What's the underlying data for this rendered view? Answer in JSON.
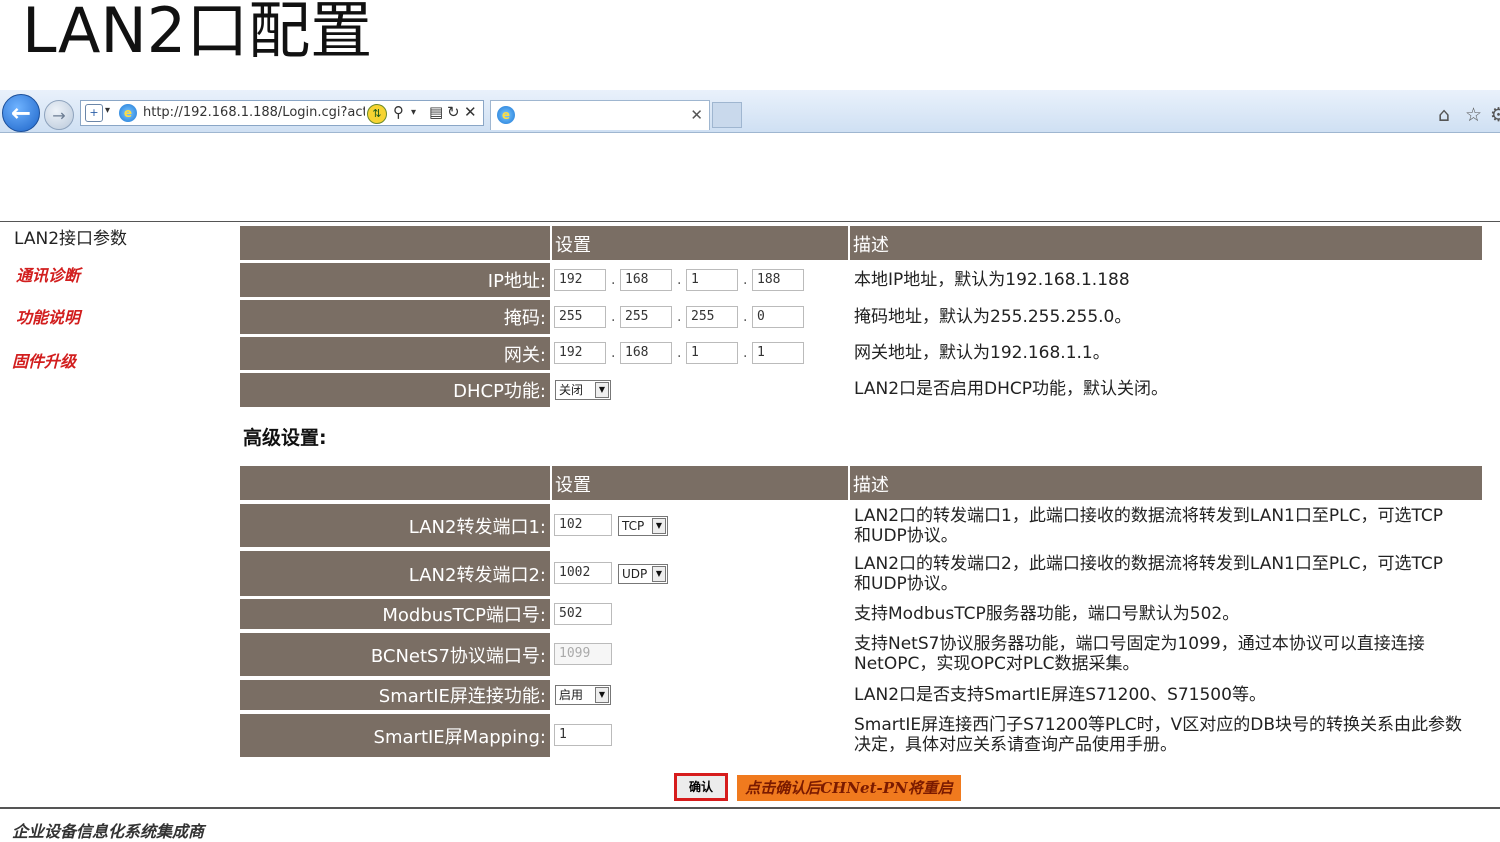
{
  "slide_title": "LAN2口配置",
  "browser": {
    "url": "http://192.168.1.188/Login.cgi?act",
    "icons": [
      "back-icon",
      "forward-icon",
      "shield-icon",
      "ie-icon",
      "compat-icon",
      "search-icon",
      "refresh-icon",
      "close-icon",
      "home-icon",
      "star-icon"
    ]
  },
  "sidebar": {
    "title": "LAN2接口参数",
    "links": [
      "通讯诊断",
      "功能说明",
      "固件升级"
    ]
  },
  "basic": {
    "header_setting": "设置",
    "header_desc": "描述",
    "ip": {
      "label": "IP地址:",
      "octets": [
        "192",
        "168",
        "1",
        "188"
      ],
      "desc": "本地IP地址，默认为192.168.1.188"
    },
    "mask": {
      "label": "掩码:",
      "octets": [
        "255",
        "255",
        "255",
        "0"
      ],
      "desc": "掩码地址，默认为255.255.255.0。"
    },
    "gateway": {
      "label": "网关:",
      "octets": [
        "192",
        "168",
        "1",
        "1"
      ],
      "desc": "网关地址，默认为192.168.1.1。"
    },
    "dhcp": {
      "label": "DHCP功能:",
      "value": "关闭",
      "desc": "LAN2口是否启用DHCP功能，默认关闭。"
    }
  },
  "advanced": {
    "title": "高级设置:",
    "header_setting": "设置",
    "header_desc": "描述",
    "port1": {
      "label": "LAN2转发端口1:",
      "value": "102",
      "proto": "TCP",
      "desc1": "LAN2口的转发端口1，此端口接收的数据流将转发到LAN1口至PLC，可选TCP",
      "desc2": "和UDP协议。"
    },
    "port2": {
      "label": "LAN2转发端口2:",
      "value": "1002",
      "proto": "UDP",
      "desc1": "LAN2口的转发端口2，此端口接收的数据流将转发到LAN1口至PLC，可选TCP",
      "desc2": "和UDP协议。"
    },
    "modbus": {
      "label": "ModbusTCP端口号:",
      "value": "502",
      "desc": "支持ModbusTCP服务器功能，端口号默认为502。"
    },
    "bcnet": {
      "label": "BCNetS7协议端口号:",
      "value": "1099",
      "desc1": "支持NetS7协议服务器功能，端口号固定为1099，通过本协议可以直接连接",
      "desc2": "NetOPC，实现OPC对PLC数据采集。"
    },
    "smartie": {
      "label": "SmartIE屏连接功能:",
      "value": "启用",
      "desc": "LAN2口是否支持SmartIE屏连S71200、S71500等。"
    },
    "mapping": {
      "label": "SmartIE屏Mapping:",
      "value": "1",
      "desc1": "SmartIE屏连接西门子S71200等PLC时，V区对应的DB块号的转换关系由此参数",
      "desc2": "决定，具体对应关系请查询产品使用手册。"
    }
  },
  "confirm_label": "确认",
  "notice": "点击确认后CHNet-PN将重启",
  "footer": "企业设备信息化系统集成商"
}
